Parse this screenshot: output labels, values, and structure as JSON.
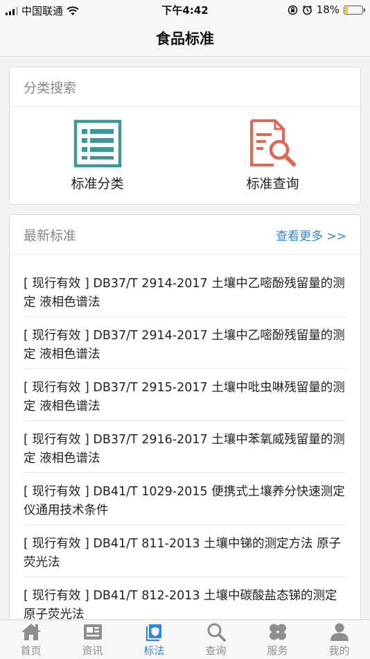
{
  "status_bar": {
    "carrier": "中国联通",
    "time": "下午4:42",
    "battery_percent_text": "18%",
    "battery_level": 0.18
  },
  "nav": {
    "title": "食品标准"
  },
  "category_section": {
    "header": "分类搜索",
    "items": [
      {
        "label": "标准分类",
        "icon": "list-icon",
        "color": "#3b9b9b"
      },
      {
        "label": "标准查询",
        "icon": "document-search-icon",
        "color": "#e0674f"
      }
    ]
  },
  "latest_section": {
    "header": "最新标准",
    "more_link": "查看更多 >>",
    "items": [
      {
        "text": "[ 现行有效 ] DB37/T 2914-2017 土壤中乙嘧酚残留量的测定 液相色谱法"
      },
      {
        "text": "[ 现行有效 ] DB37/T 2914-2017 土壤中乙嘧酚残留量的测定 液相色谱法"
      },
      {
        "text": "[ 现行有效 ] DB37/T 2915-2017 土壤中吡虫啉残留量的测定 液相色谱法"
      },
      {
        "text": "[ 现行有效 ] DB37/T 2916-2017 土壤中苯氧威残留量的测定 液相色谱法"
      },
      {
        "text": "[ 现行有效 ] DB41/T 1029-2015 便携式土壤养分快速测定仪通用技术条件"
      },
      {
        "text": "[ 现行有效 ] DB41/T 811-2013 土壤中锑的测定方法 原子荧光法"
      },
      {
        "text": "[ 现行有效 ] DB41/T 812-2013 土壤中碳酸盐态锑的测定 原子荧光法"
      }
    ]
  },
  "tab_bar": {
    "active_color": "#2f86d6",
    "inactive_color": "#8e8e8e",
    "tabs": [
      {
        "label": "首页",
        "icon": "home-icon"
      },
      {
        "label": "资讯",
        "icon": "news-icon"
      },
      {
        "label": "标法",
        "icon": "standard-icon",
        "active": true
      },
      {
        "label": "查询",
        "icon": "search-icon"
      },
      {
        "label": "服务",
        "icon": "service-icon"
      },
      {
        "label": "我的",
        "icon": "user-icon"
      }
    ]
  }
}
